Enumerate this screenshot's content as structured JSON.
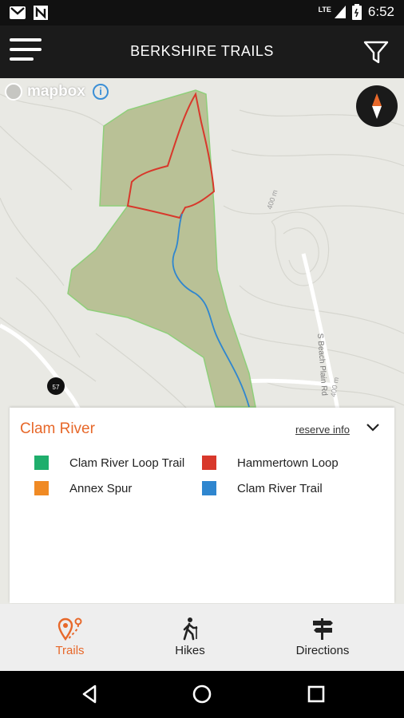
{
  "status_bar": {
    "time": "6:52",
    "network": "LTE"
  },
  "app_bar": {
    "title": "BERKSHIRE TRAILS"
  },
  "map": {
    "attribution": "mapbox",
    "road_label": "S Beach Plain Rd",
    "contour_label_1": "400 m",
    "contour_label_2": "400 m",
    "route_shield": "57"
  },
  "reserve_panel": {
    "name": "Clam River",
    "reserve_info_label": "reserve info",
    "trails": [
      {
        "name": "Clam River Loop Trail",
        "color": "#1fae6c"
      },
      {
        "name": "Hammertown Loop",
        "color": "#d8382b"
      },
      {
        "name": "Annex Spur",
        "color": "#f08a24"
      },
      {
        "name": "Clam River Trail",
        "color": "#2f86cf"
      }
    ]
  },
  "bottom_nav": {
    "tabs": [
      {
        "label": "Trails",
        "icon": "trail-pin-icon",
        "active": true
      },
      {
        "label": "Hikes",
        "icon": "hiker-icon",
        "active": false
      },
      {
        "label": "Directions",
        "icon": "signpost-icon",
        "active": false
      }
    ]
  },
  "colors": {
    "accent": "#e7682a",
    "appbar": "#1b1b1b",
    "reserve_fill": "#b9c196"
  }
}
